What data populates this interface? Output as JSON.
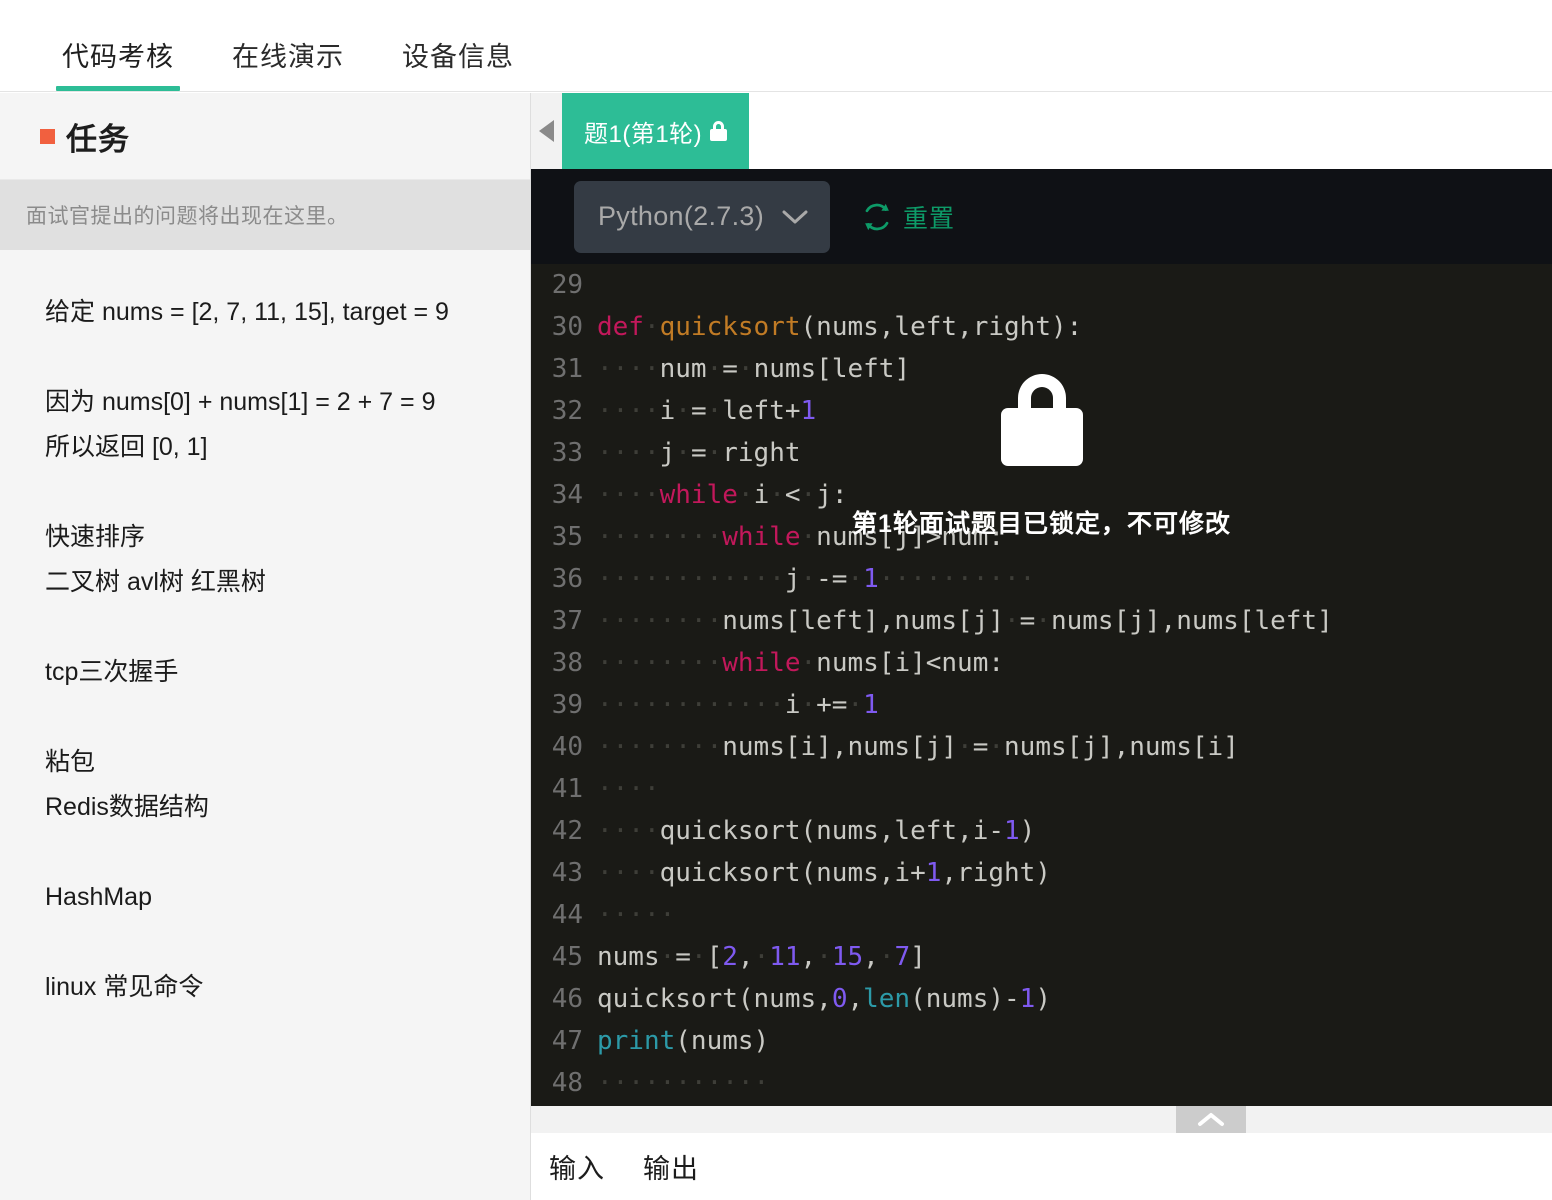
{
  "top_tabs": [
    {
      "label": "代码考核",
      "active": true
    },
    {
      "label": "在线演示",
      "active": false
    },
    {
      "label": "设备信息",
      "active": false
    }
  ],
  "sidebar": {
    "title": "任务",
    "bullet_color": "#f1603f",
    "placeholder": "面试官提出的问题将出现在这里。",
    "blocks": [
      "给定 nums = [2, 7, 11, 15], target = 9",
      "因为 nums[0] + nums[1] = 2 + 7 = 9\n所以返回 [0, 1]",
      " 快速排序\n二叉树  avl树  红黑树",
      "tcp三次握手",
      "粘包\nRedis数据结构",
      "HashMap",
      "linux 常见命令"
    ]
  },
  "question_tabs": {
    "prev_arrow_icon": "triangle-left-icon",
    "tabs": [
      {
        "label": "题1(第1轮)",
        "locked": true,
        "active": true,
        "lock_icon": "lock-icon"
      }
    ]
  },
  "toolbar": {
    "language": "Python(2.7.3)",
    "language_chevron_icon": "chevron-down-icon",
    "reset_label": "重置",
    "reset_icon": "refresh-icon",
    "accent_color": "#0d9b68"
  },
  "editor": {
    "first_line_number": 29,
    "lines": [
      {
        "n": 29,
        "tokens": []
      },
      {
        "n": 30,
        "tokens": [
          {
            "t": "def",
            "c": "kw"
          },
          {
            "t": "·",
            "c": "ws"
          },
          {
            "t": "quicksort",
            "c": "fn"
          },
          {
            "t": "(nums,left,right):",
            "c": ""
          }
        ]
      },
      {
        "n": 31,
        "tokens": [
          {
            "t": "····",
            "c": "ws"
          },
          {
            "t": "num",
            "c": ""
          },
          {
            "t": "·",
            "c": "ws"
          },
          {
            "t": "=",
            "c": ""
          },
          {
            "t": "·",
            "c": "ws"
          },
          {
            "t": "nums[left]",
            "c": ""
          }
        ]
      },
      {
        "n": 32,
        "tokens": [
          {
            "t": "····",
            "c": "ws"
          },
          {
            "t": "i",
            "c": ""
          },
          {
            "t": "·",
            "c": "ws"
          },
          {
            "t": "=",
            "c": ""
          },
          {
            "t": "·",
            "c": "ws"
          },
          {
            "t": "left+",
            "c": ""
          },
          {
            "t": "1",
            "c": "num"
          }
        ]
      },
      {
        "n": 33,
        "tokens": [
          {
            "t": "····",
            "c": "ws"
          },
          {
            "t": "j",
            "c": ""
          },
          {
            "t": "·",
            "c": "ws"
          },
          {
            "t": "=",
            "c": ""
          },
          {
            "t": "·",
            "c": "ws"
          },
          {
            "t": "right",
            "c": ""
          }
        ]
      },
      {
        "n": 34,
        "tokens": [
          {
            "t": "····",
            "c": "ws"
          },
          {
            "t": "while",
            "c": "kw"
          },
          {
            "t": "·",
            "c": "ws"
          },
          {
            "t": "i",
            "c": ""
          },
          {
            "t": "·",
            "c": "ws"
          },
          {
            "t": "<",
            "c": ""
          },
          {
            "t": "·",
            "c": "ws"
          },
          {
            "t": "j:",
            "c": ""
          }
        ]
      },
      {
        "n": 35,
        "tokens": [
          {
            "t": "········",
            "c": "ws"
          },
          {
            "t": "while",
            "c": "kw"
          },
          {
            "t": "·",
            "c": "ws"
          },
          {
            "t": "nums[j]>num:",
            "c": ""
          }
        ]
      },
      {
        "n": 36,
        "tokens": [
          {
            "t": "············",
            "c": "ws"
          },
          {
            "t": "j",
            "c": ""
          },
          {
            "t": "·",
            "c": "ws"
          },
          {
            "t": "-=",
            "c": ""
          },
          {
            "t": "·",
            "c": "ws"
          },
          {
            "t": "1",
            "c": "num"
          },
          {
            "t": "··········",
            "c": "ws"
          }
        ]
      },
      {
        "n": 37,
        "tokens": [
          {
            "t": "········",
            "c": "ws"
          },
          {
            "t": "nums[left],nums[j]",
            "c": ""
          },
          {
            "t": "·",
            "c": "ws"
          },
          {
            "t": "=",
            "c": ""
          },
          {
            "t": "·",
            "c": "ws"
          },
          {
            "t": "nums[j],nums[left]",
            "c": ""
          }
        ]
      },
      {
        "n": 38,
        "tokens": [
          {
            "t": "········",
            "c": "ws"
          },
          {
            "t": "while",
            "c": "kw"
          },
          {
            "t": "·",
            "c": "ws"
          },
          {
            "t": "nums[i]<num:",
            "c": ""
          }
        ]
      },
      {
        "n": 39,
        "tokens": [
          {
            "t": "············",
            "c": "ws"
          },
          {
            "t": "i",
            "c": ""
          },
          {
            "t": "·",
            "c": "ws"
          },
          {
            "t": "+=",
            "c": ""
          },
          {
            "t": "·",
            "c": "ws"
          },
          {
            "t": "1",
            "c": "num"
          }
        ]
      },
      {
        "n": 40,
        "tokens": [
          {
            "t": "········",
            "c": "ws"
          },
          {
            "t": "nums[i],nums[j]",
            "c": ""
          },
          {
            "t": "·",
            "c": "ws"
          },
          {
            "t": "=",
            "c": ""
          },
          {
            "t": "·",
            "c": "ws"
          },
          {
            "t": "nums[j],nums[i]",
            "c": ""
          }
        ]
      },
      {
        "n": 41,
        "tokens": [
          {
            "t": "····",
            "c": "ws"
          }
        ]
      },
      {
        "n": 42,
        "tokens": [
          {
            "t": "····",
            "c": "ws"
          },
          {
            "t": "quicksort(nums,left,i-",
            "c": ""
          },
          {
            "t": "1",
            "c": "num"
          },
          {
            "t": ")",
            "c": ""
          }
        ]
      },
      {
        "n": 43,
        "tokens": [
          {
            "t": "····",
            "c": "ws"
          },
          {
            "t": "quicksort(nums,i+",
            "c": ""
          },
          {
            "t": "1",
            "c": "num"
          },
          {
            "t": ",right)",
            "c": ""
          }
        ]
      },
      {
        "n": 44,
        "tokens": [
          {
            "t": "·····",
            "c": "ws"
          }
        ]
      },
      {
        "n": 45,
        "tokens": [
          {
            "t": "nums",
            "c": ""
          },
          {
            "t": "·",
            "c": "ws"
          },
          {
            "t": "=",
            "c": ""
          },
          {
            "t": "·",
            "c": "ws"
          },
          {
            "t": "[",
            "c": ""
          },
          {
            "t": "2",
            "c": "num"
          },
          {
            "t": ",",
            "c": ""
          },
          {
            "t": "·",
            "c": "ws"
          },
          {
            "t": "11",
            "c": "num"
          },
          {
            "t": ",",
            "c": ""
          },
          {
            "t": "·",
            "c": "ws"
          },
          {
            "t": "15",
            "c": "num"
          },
          {
            "t": ",",
            "c": ""
          },
          {
            "t": "·",
            "c": "ws"
          },
          {
            "t": "7",
            "c": "num"
          },
          {
            "t": "]",
            "c": ""
          }
        ]
      },
      {
        "n": 46,
        "tokens": [
          {
            "t": "quicksort(nums,",
            "c": ""
          },
          {
            "t": "0",
            "c": "num"
          },
          {
            "t": ",",
            "c": ""
          },
          {
            "t": "len",
            "c": "bi"
          },
          {
            "t": "(nums)-",
            "c": ""
          },
          {
            "t": "1",
            "c": "num"
          },
          {
            "t": ")",
            "c": ""
          }
        ]
      },
      {
        "n": 47,
        "tokens": [
          {
            "t": "print",
            "c": "bi"
          },
          {
            "t": "(nums)",
            "c": ""
          }
        ]
      },
      {
        "n": 48,
        "tokens": [
          {
            "t": "···········",
            "c": "ws"
          }
        ]
      }
    ],
    "lock_overlay": {
      "icon": "lock-icon",
      "message": "第1轮面试题目已锁定，不可修改"
    }
  },
  "io_panel": {
    "collapse_icon": "chevron-up-icon",
    "tabs": [
      {
        "label": "输入",
        "active": true
      },
      {
        "label": "输出",
        "active": false
      }
    ]
  }
}
